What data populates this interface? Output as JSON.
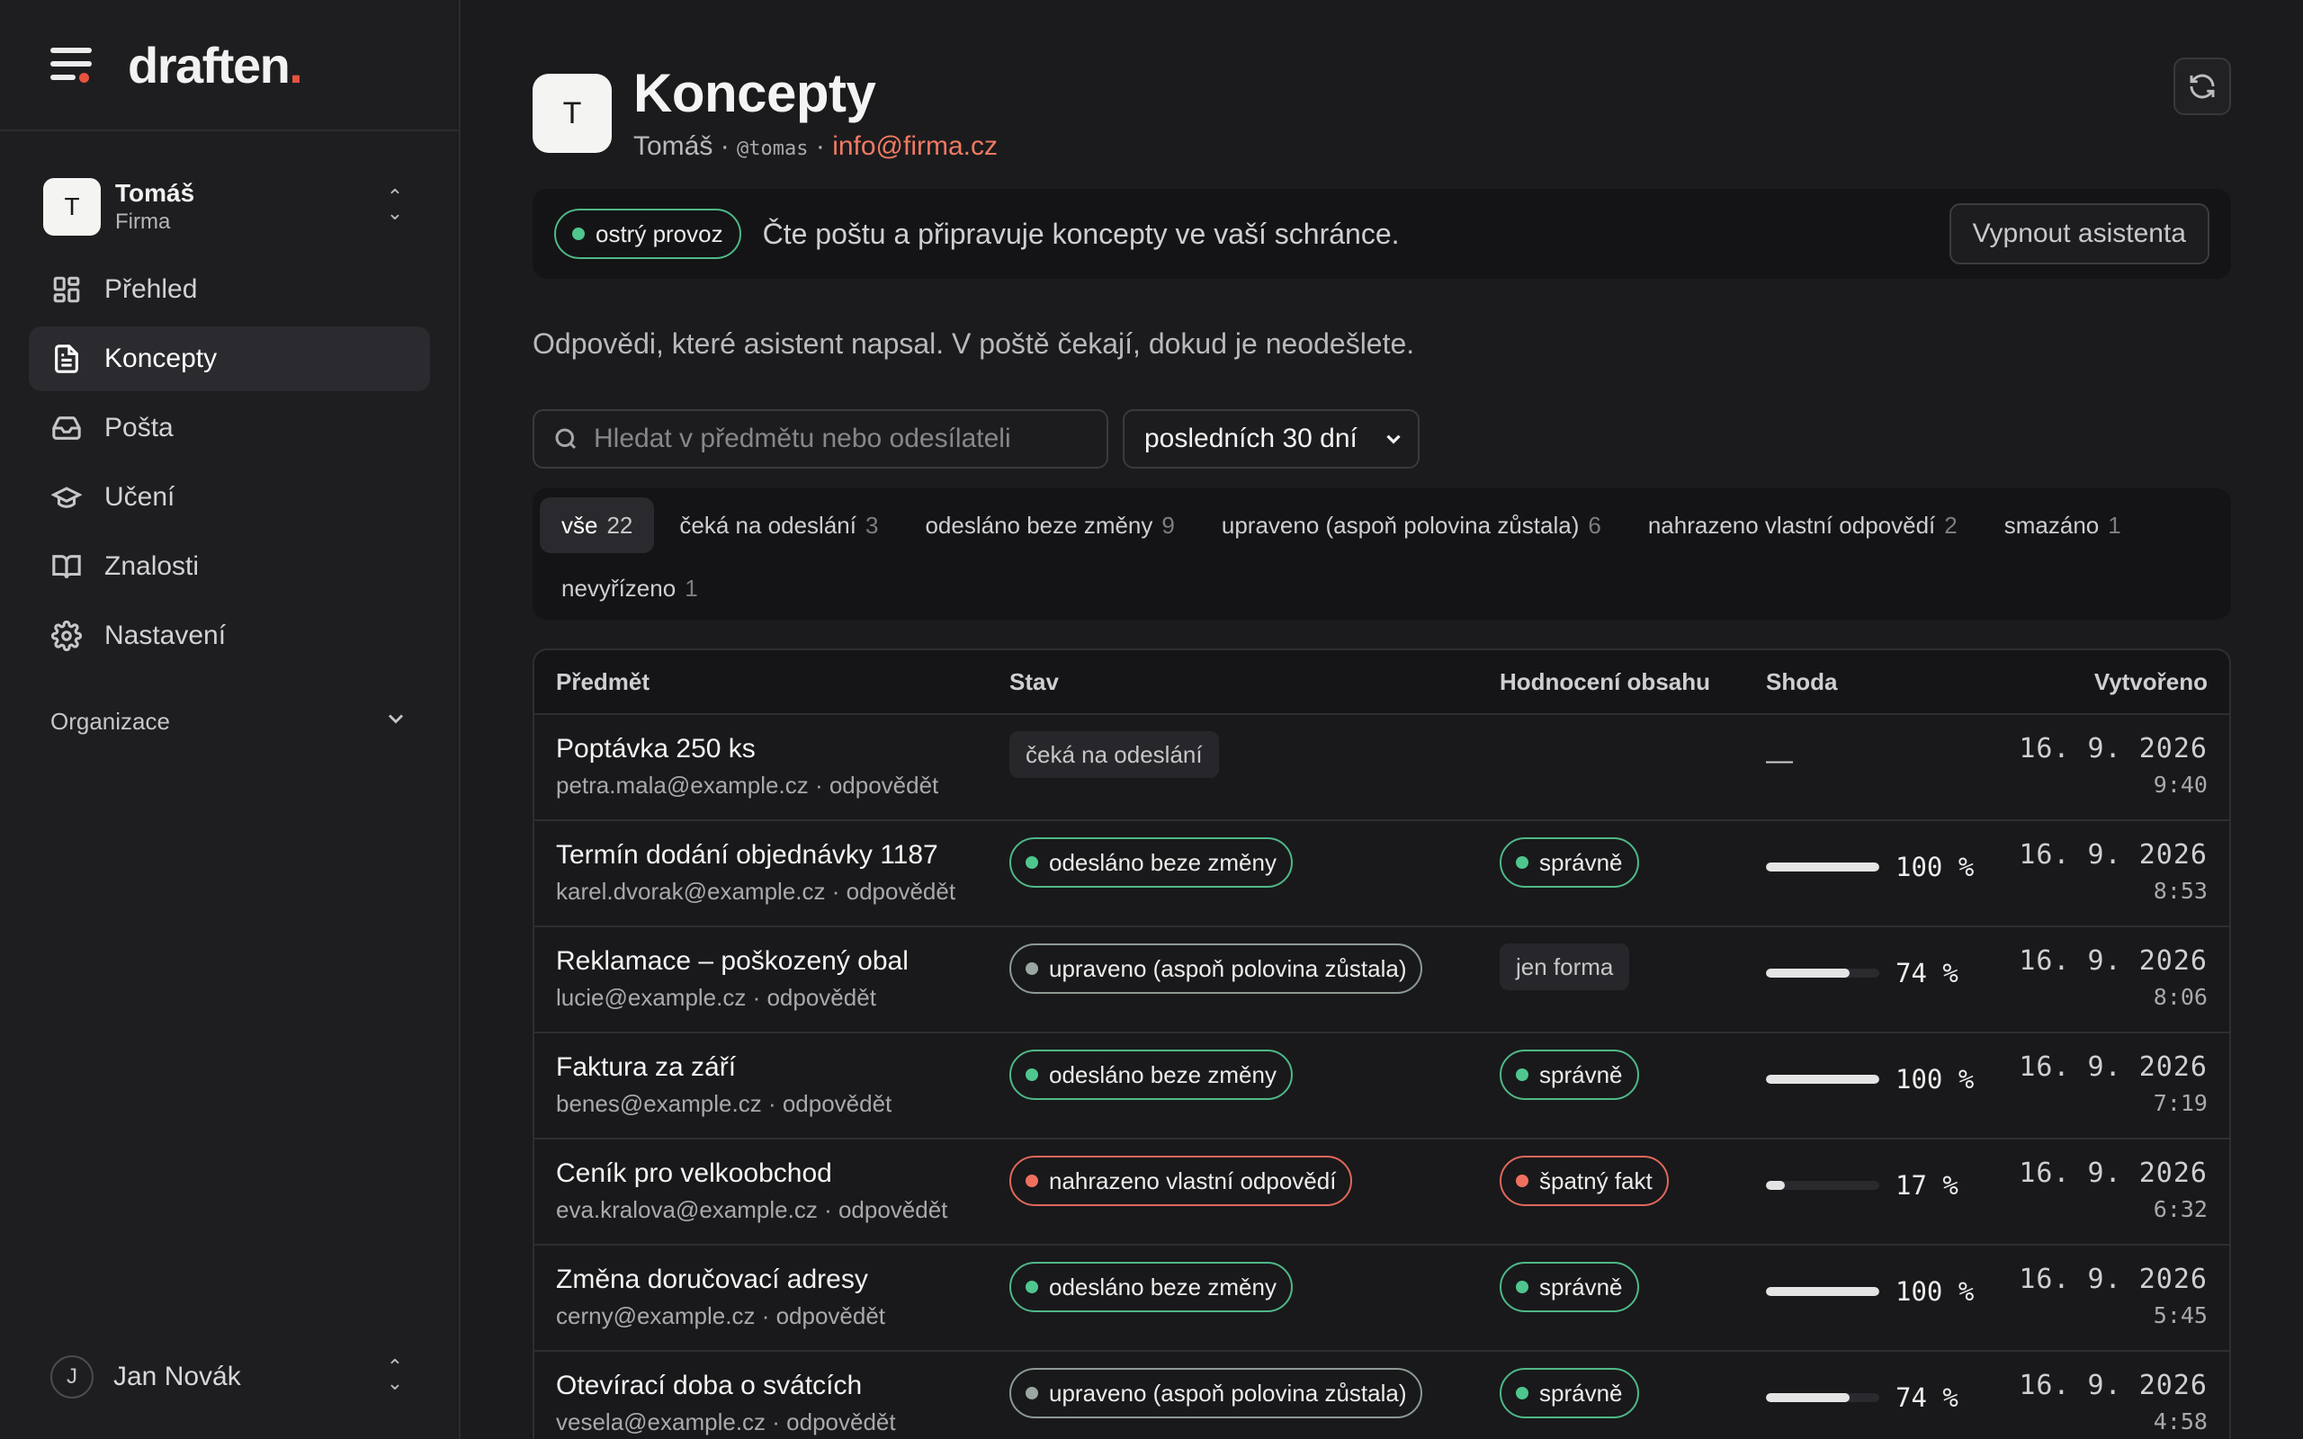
{
  "brand": {
    "name": "draften",
    "dot": "."
  },
  "account": {
    "initial": "T",
    "name": "Tomáš",
    "org": "Firma"
  },
  "nav": [
    {
      "label": "Přehled",
      "icon": "dashboard-icon",
      "active": false
    },
    {
      "label": "Koncepty",
      "icon": "document-icon",
      "active": true
    },
    {
      "label": "Pošta",
      "icon": "inbox-icon",
      "active": false
    },
    {
      "label": "Učení",
      "icon": "graduation-cap-icon",
      "active": false
    },
    {
      "label": "Znalosti",
      "icon": "book-icon",
      "active": false
    },
    {
      "label": "Nastavení",
      "icon": "gear-icon",
      "active": false
    }
  ],
  "org_section": {
    "label": "Organizace"
  },
  "user": {
    "initial": "J",
    "name": "Jan Novák"
  },
  "header": {
    "initial": "T",
    "title": "Koncepty",
    "name": "Tomáš",
    "sep": " · ",
    "handle": "@tomas",
    "email": "info@firma.cz"
  },
  "status": {
    "badge": "ostrý provoz",
    "text": "Čte poštu a připravuje koncepty ve vaší schránce.",
    "button": "Vypnout asistenta"
  },
  "intro": "Odpovědi, které asistent napsal. V poště čekají, dokud je neodešlete.",
  "search": {
    "placeholder": "Hledat v předmětu nebo odesílateli",
    "value": ""
  },
  "period": {
    "selected": "posledních 30 dní"
  },
  "tabs": [
    {
      "label": "vše",
      "count": "22",
      "active": true
    },
    {
      "label": "čeká na odeslání",
      "count": "3",
      "active": false
    },
    {
      "label": "odesláno beze změny",
      "count": "9",
      "active": false
    },
    {
      "label": "upraveno (aspoň polovina zůstala)",
      "count": "6",
      "active": false
    },
    {
      "label": "nahrazeno vlastní odpovědí",
      "count": "2",
      "active": false
    },
    {
      "label": "smazáno",
      "count": "1",
      "active": false
    },
    {
      "label": "nevyřízeno",
      "count": "1",
      "active": false
    }
  ],
  "table": {
    "headers": {
      "subject": "Předmět",
      "status": "Stav",
      "rating": "Hodnocení obsahu",
      "match": "Shoda",
      "created": "Vytvořeno"
    },
    "rows": [
      {
        "subject": "Poptávka 250 ks",
        "sender": "petra.mala@example.cz · odpovědět",
        "status": "čeká na odeslání",
        "status_style": "flat",
        "rating": "",
        "rating_style": "none",
        "match": null,
        "match_text": "—",
        "date": "16. 9. 2026",
        "time": "9:40"
      },
      {
        "subject": "Termín dodání objednávky 1187",
        "sender": "karel.dvorak@example.cz · odpovědět",
        "status": "odesláno beze změny",
        "status_style": "green",
        "rating": "správně",
        "rating_style": "green",
        "match": 100,
        "match_text": "100 %",
        "date": "16. 9. 2026",
        "time": "8:53"
      },
      {
        "subject": "Reklamace – poškozený obal",
        "sender": "lucie@example.cz · odpovědět",
        "status": "upraveno (aspoň polovina zůstala)",
        "status_style": "grey",
        "rating": "jen forma",
        "rating_style": "flat",
        "match": 74,
        "match_text": "74 %",
        "date": "16. 9. 2026",
        "time": "8:06"
      },
      {
        "subject": "Faktura za září",
        "sender": "benes@example.cz · odpovědět",
        "status": "odesláno beze změny",
        "status_style": "green",
        "rating": "správně",
        "rating_style": "green",
        "match": 100,
        "match_text": "100 %",
        "date": "16. 9. 2026",
        "time": "7:19"
      },
      {
        "subject": "Ceník pro velkoobchod",
        "sender": "eva.kralova@example.cz · odpovědět",
        "status": "nahrazeno vlastní odpovědí",
        "status_style": "red",
        "rating": "špatný fakt",
        "rating_style": "red",
        "match": 17,
        "match_text": "17 %",
        "date": "16. 9. 2026",
        "time": "6:32"
      },
      {
        "subject": "Změna doručovací adresy",
        "sender": "cerny@example.cz · odpovědět",
        "status": "odesláno beze změny",
        "status_style": "green",
        "rating": "správně",
        "rating_style": "green",
        "match": 100,
        "match_text": "100 %",
        "date": "16. 9. 2026",
        "time": "5:45"
      },
      {
        "subject": "Otevírací doba o svátcích",
        "sender": "vesela@example.cz · odpovědět",
        "status": "upraveno (aspoň polovina zůstala)",
        "status_style": "grey",
        "rating": "správně",
        "rating_style": "green",
        "match": 74,
        "match_text": "74 %",
        "date": "16. 9. 2026",
        "time": "4:58"
      }
    ]
  },
  "colors": {
    "accent": "#e8533f",
    "email": "#ef7a62",
    "ok": "#4fc68d",
    "error": "#f07060",
    "neutral": "#9ba7a1"
  }
}
